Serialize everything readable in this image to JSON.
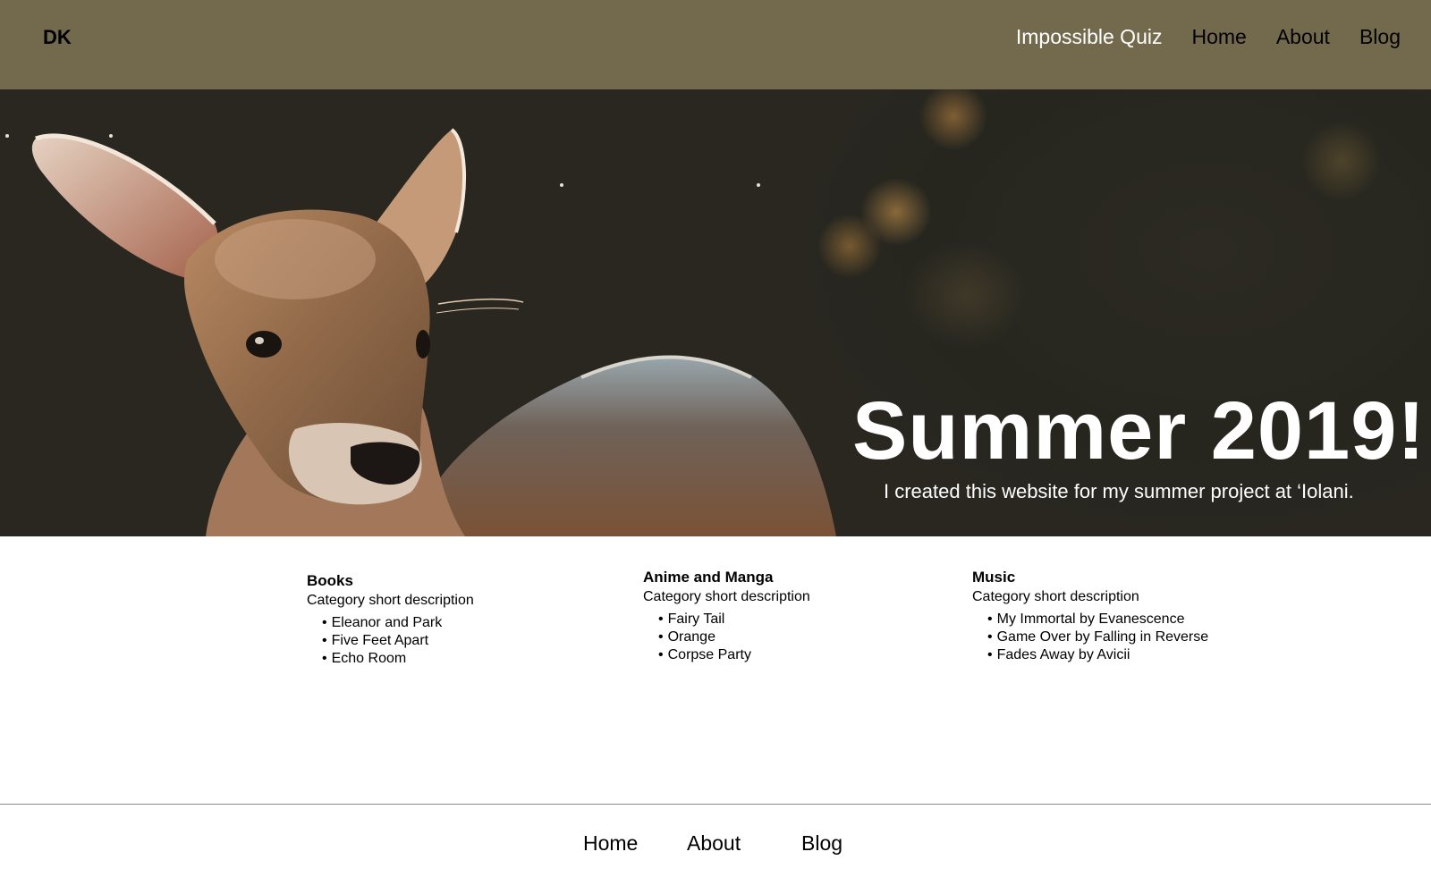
{
  "header": {
    "logo": "DK",
    "nav": [
      "Impossible Quiz",
      "Home",
      "About",
      "Blog"
    ]
  },
  "hero": {
    "title": "Summer 2019!",
    "subtitle": "I created this website for my summer project at ‘Iolani."
  },
  "categories": [
    {
      "title": "Books",
      "description": "Category short description",
      "items": [
        "Eleanor and Park",
        "Five Feet Apart",
        "Echo Room"
      ]
    },
    {
      "title": "Anime and Manga",
      "description": "Category short description",
      "items": [
        "Fairy Tail",
        "Orange",
        "Corpse Party"
      ]
    },
    {
      "title": "Music",
      "description": "Category short description",
      "items": [
        "My Immortal by Evanescence",
        "Game Over by Falling in Reverse",
        "Fades Away by Avicii"
      ]
    }
  ],
  "footer": {
    "nav": [
      "Home",
      "About",
      "Blog"
    ]
  },
  "colors": {
    "header_bg": "#736a4e",
    "hero_text": "#ffffff"
  }
}
